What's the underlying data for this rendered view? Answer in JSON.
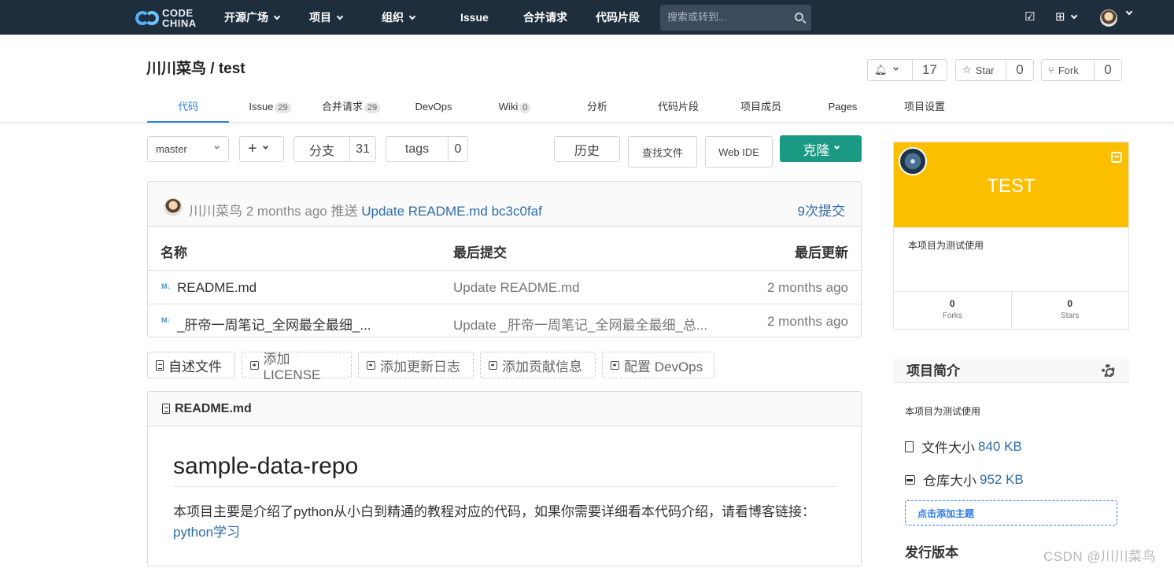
{
  "nav": {
    "logo_line1": "CODE",
    "logo_line2": "CHINA",
    "items": [
      "开源广场",
      "项目",
      "组织",
      "Issue",
      "合并请求",
      "代码片段"
    ],
    "search_placeholder": "搜索或转到..."
  },
  "repo": {
    "title": "川川菜鸟 / test",
    "watch_count": "17",
    "star_label": "Star",
    "star_count": "0",
    "fork_label": "Fork",
    "fork_count": "0"
  },
  "tabs": [
    {
      "label": "代码",
      "badge": ""
    },
    {
      "label": "Issue",
      "badge": "29"
    },
    {
      "label": "合并请求",
      "badge": "29"
    },
    {
      "label": "DevOps",
      "badge": ""
    },
    {
      "label": "Wiki",
      "badge": "0"
    },
    {
      "label": "分析",
      "badge": ""
    },
    {
      "label": "代码片段",
      "badge": ""
    },
    {
      "label": "项目成员",
      "badge": ""
    },
    {
      "label": "Pages",
      "badge": ""
    },
    {
      "label": "项目设置",
      "badge": ""
    }
  ],
  "toolbar": {
    "branch": "master",
    "plus": "+",
    "branches_label": "分支",
    "branches_count": "31",
    "tags_label": "tags",
    "tags_count": "0",
    "history": "历史",
    "find_file": "查找文件",
    "web_ide": "Web IDE",
    "clone": "克隆"
  },
  "commit": {
    "author": "川川菜鸟",
    "time": "2 months ago",
    "action": "推送",
    "message": "Update README.md",
    "hash": "bc3c0faf",
    "count": "9次提交"
  },
  "table": {
    "headers": [
      "名称",
      "最后提交",
      "最后更新"
    ],
    "rows": [
      {
        "icon": "M↓",
        "name": "README.md",
        "message": "Update README.md",
        "date": "2 months ago"
      },
      {
        "icon": "M↓",
        "name": "_肝帝一周笔记_全网最全最细_...",
        "message": "Update _肝帝一周笔记_全网最全最细_总...",
        "date": "2 months ago"
      }
    ]
  },
  "readme_actions": [
    "自述文件",
    "添加LICENSE",
    "添加更新日志",
    "添加贡献信息",
    "配置 DevOps"
  ],
  "readme": {
    "filename": "README.md",
    "heading": "sample-data-repo",
    "paragraph": "本项目主要是介绍了python从小白到精通的教程对应的代码，如果你需要详细看本代码介绍，请看博客链接：",
    "link": "python学习"
  },
  "sidebar": {
    "card_title": "TEST",
    "card_desc": "本项目为测试使用",
    "forks_count": "0",
    "forks_label": "Forks",
    "stars_count": "0",
    "stars_label": "Stars",
    "intro_title": "项目简介",
    "intro_desc": "本项目为测试使用",
    "file_size_label": "文件大小",
    "file_size": "840 KB",
    "repo_size_label": "仓库大小",
    "repo_size": "952 KB",
    "add_topic": "点击添加主题",
    "release_title": "发行版本"
  },
  "watermark": "CSDN @川川菜鸟",
  "colors": {
    "nav_bg": "#1f2e3d",
    "accent": "#2b7de9",
    "clone_btn": "#1b9a83",
    "card_bg": "#fcbf00",
    "link": "#2f6ca8"
  }
}
